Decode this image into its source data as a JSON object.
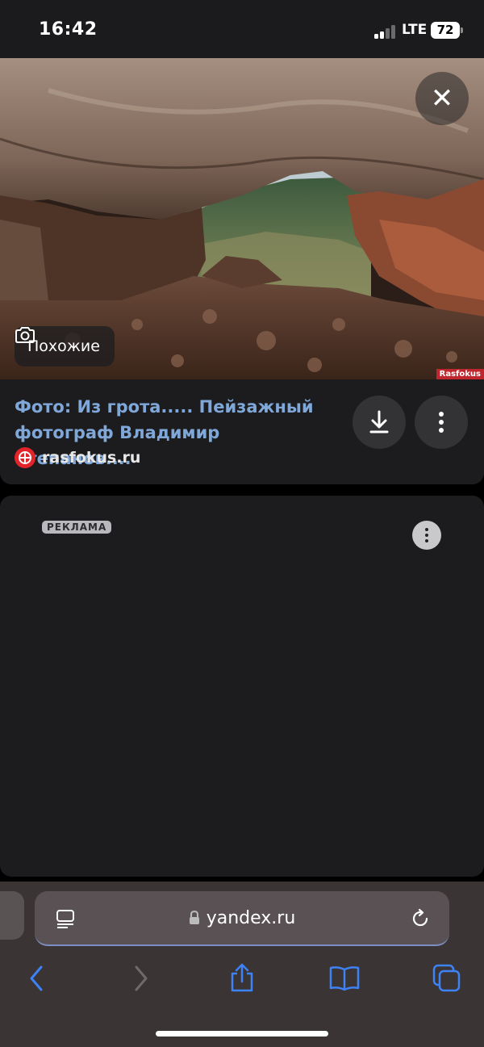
{
  "status_bar": {
    "time": "16:42",
    "network": "LTE",
    "battery": "72"
  },
  "photo": {
    "similar_label": "Похожие",
    "watermark": "Rasfokus"
  },
  "result": {
    "title": "Фото: Из грота..... Пейзажный фотограф Владимир Степанов....",
    "source": "rasfokus.ru"
  },
  "ad": {
    "label": "РЕКЛАМА"
  },
  "browser": {
    "url": "yandex.ru"
  },
  "colors": {
    "link": "#7fa7d8",
    "toolbar_accent": "#3d82f6",
    "source_logo": "#e3242b"
  },
  "icons": [
    "close-icon",
    "camera-search-icon",
    "download-icon",
    "more-icon",
    "reader-icon",
    "lock-icon",
    "reload-icon",
    "back-icon",
    "forward-icon",
    "share-icon",
    "bookmarks-icon",
    "tabs-icon"
  ]
}
